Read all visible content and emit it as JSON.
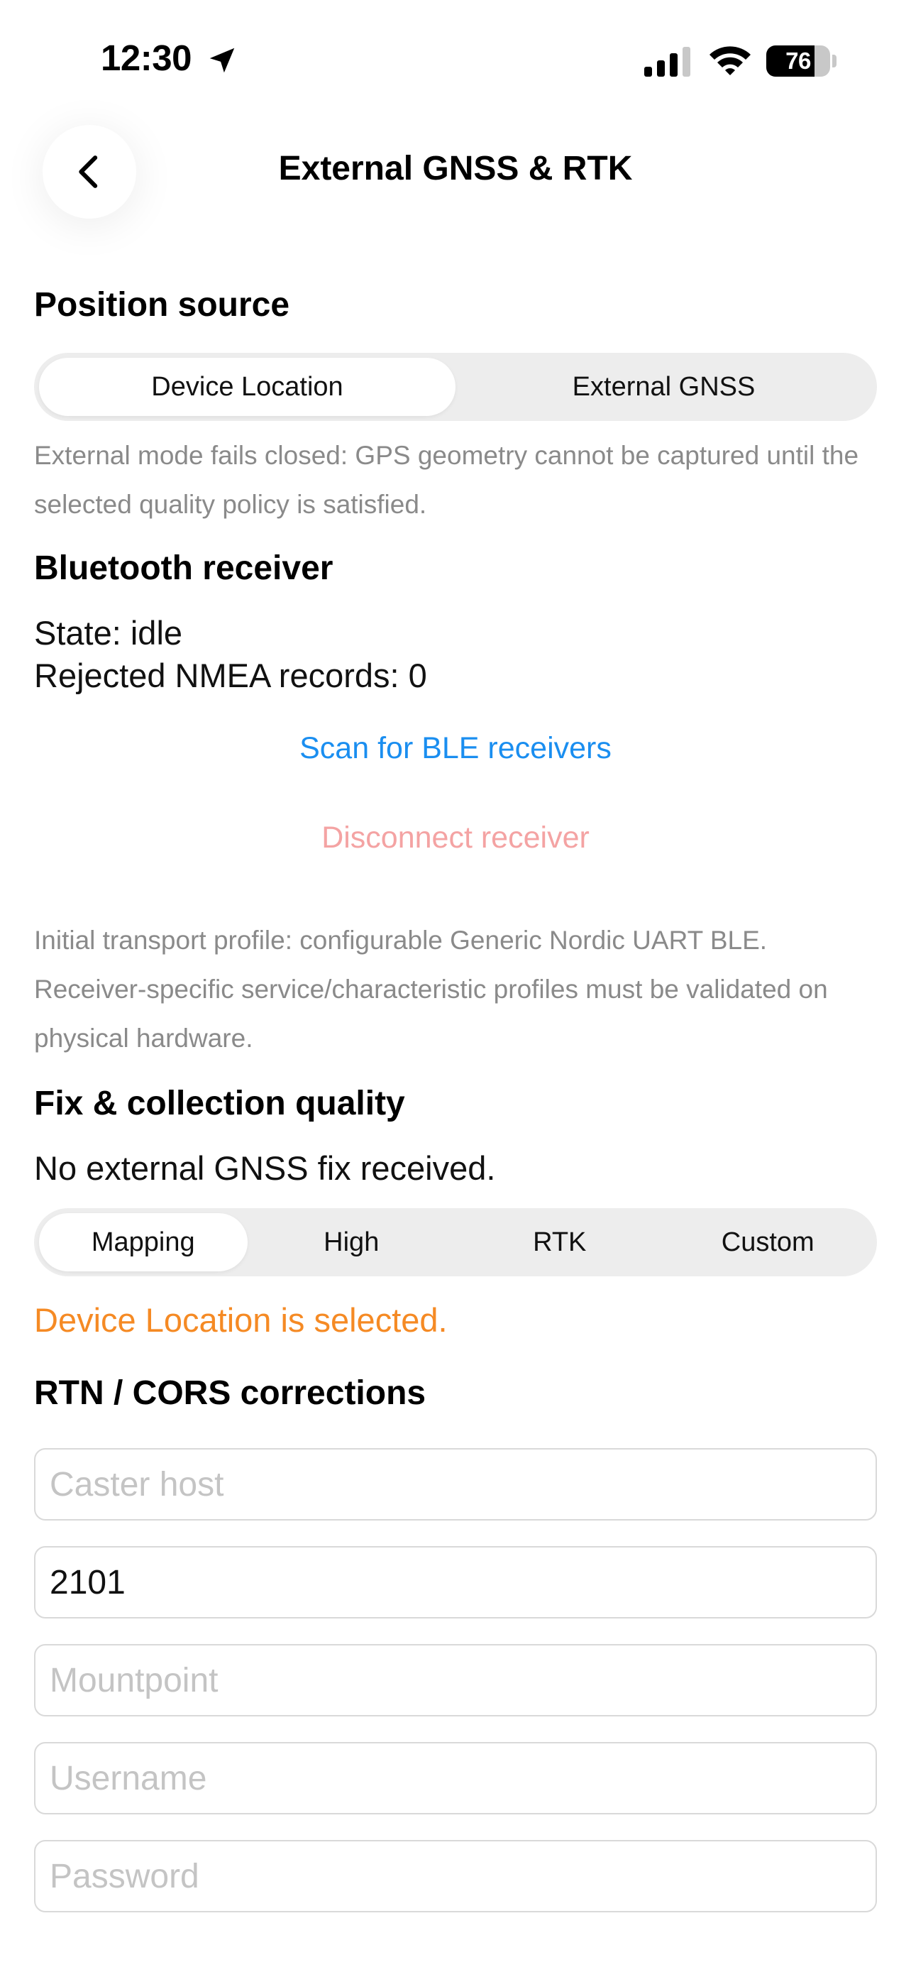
{
  "status_bar": {
    "time": "12:30",
    "battery_percent": "76",
    "battery_level": 0.76
  },
  "header": {
    "title": "External GNSS & RTK",
    "back_icon": "chevron-left-icon"
  },
  "position_source": {
    "title": "Position source",
    "options": [
      "Device Location",
      "External GNSS"
    ],
    "selected": "Device Location",
    "hint": "External mode fails closed: GPS geometry cannot be captured until the selected quality policy is satisfied."
  },
  "bluetooth": {
    "title": "Bluetooth receiver",
    "state_line": "State: idle",
    "rejected_line": "Rejected NMEA records: 0",
    "scan_label": "Scan for BLE receivers",
    "disconnect_label": "Disconnect receiver",
    "hint": "Initial transport profile: configurable Generic Nordic UART BLE. Receiver-specific service/characteristic profiles must be validated on physical hardware."
  },
  "fix_quality": {
    "title": "Fix & collection quality",
    "status": "No external GNSS fix received.",
    "options": [
      "Mapping",
      "High",
      "RTK",
      "Custom"
    ],
    "selected": "Mapping",
    "warning": "Device Location is selected."
  },
  "corrections": {
    "title": "RTN / CORS corrections",
    "caster_host": {
      "placeholder": "Caster host",
      "value": ""
    },
    "port": {
      "placeholder": "",
      "value": "2101"
    },
    "mountpoint": {
      "placeholder": "Mountpoint",
      "value": ""
    },
    "username": {
      "placeholder": "Username",
      "value": ""
    },
    "password": {
      "placeholder": "Password",
      "value": ""
    }
  },
  "colors": {
    "link": "#1a8ef0",
    "danger": "#f4a3a3",
    "warning": "#f58a24",
    "segment_bg": "#ededed"
  }
}
